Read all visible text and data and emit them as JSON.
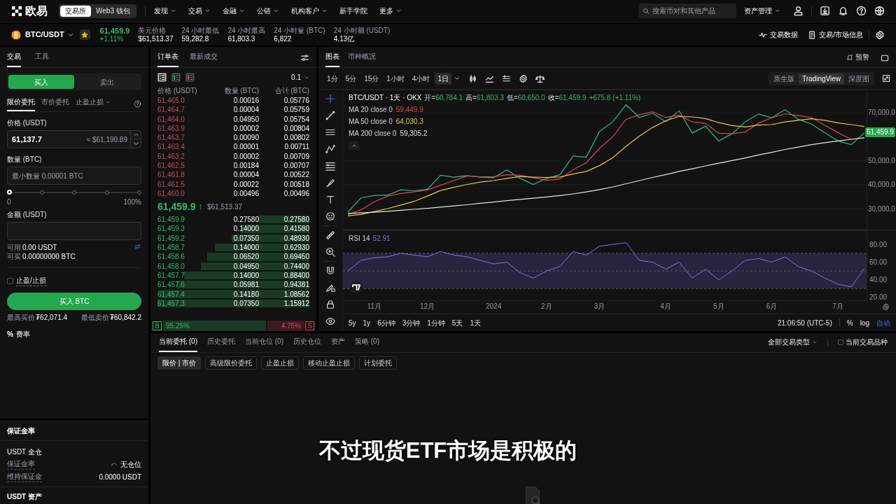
{
  "nav": {
    "logo_text": "欧易",
    "segments": [
      {
        "label": "交易所",
        "selected": true
      },
      {
        "label": "Web3 钱包",
        "selected": false
      }
    ],
    "menu": [
      {
        "label": "发现",
        "dropdown": true
      },
      {
        "label": "交易",
        "dropdown": true
      },
      {
        "label": "金融",
        "dropdown": true
      },
      {
        "label": "公链",
        "dropdown": true
      },
      {
        "label": "机构客户",
        "dropdown": true
      },
      {
        "label": "新手学院",
        "dropdown": false
      },
      {
        "label": "更多",
        "dropdown": true
      }
    ],
    "search": {
      "placeholder": "搜索币对和其他产品"
    },
    "asset_menu": "资产管理"
  },
  "ticker": {
    "pair": "BTC/USDT",
    "favorite": true,
    "last": "61,459.9",
    "change": "+1.11%",
    "stats": [
      {
        "label": "美元价格",
        "value": "$61,513.37"
      },
      {
        "label": "24 小时最低",
        "value": "59,282.8"
      },
      {
        "label": "24 小时最高",
        "value": "61,803.3"
      },
      {
        "label": "24 小时量 (BTC)",
        "value": "6,822"
      },
      {
        "label": "24 小时额 (USDT)",
        "value": "4.13亿"
      }
    ],
    "links": [
      {
        "label": "交易数据",
        "kind": "pulse"
      },
      {
        "label": "交易/市场信息",
        "kind": "doc"
      }
    ]
  },
  "trade_panel": {
    "tabs": [
      {
        "label": "交易",
        "selected": true
      },
      {
        "label": "工具",
        "selected": false
      }
    ],
    "sides": [
      {
        "label": "买入",
        "selected": true
      },
      {
        "label": "卖出",
        "selected": false
      }
    ],
    "order_types": [
      {
        "label": "限价委托",
        "selected": true,
        "dropdown": false
      },
      {
        "label": "市价委托",
        "selected": false,
        "dropdown": false
      },
      {
        "label": "止盈止损",
        "selected": false,
        "dropdown": true
      }
    ],
    "price_label": "价格 (USDT)",
    "price_value": "61,137.7",
    "price_usd": "≈ $61,190.89",
    "qty_label": "数量 (BTC)",
    "qty_placeholder": "最小数量 0.00001 BTC",
    "slider": {
      "level": 0,
      "min_label": "0",
      "max_label": "100%"
    },
    "amount_label": "金额 (USDT)",
    "available": [
      {
        "label": "可用",
        "value": "0.00 USDT"
      },
      {
        "label": "可买",
        "value": "0.00000000 BTC"
      }
    ],
    "tpsl": {
      "label": "止盈/止损",
      "checked": false
    },
    "submit": "买入 BTC",
    "limits": [
      {
        "label": "最高买价",
        "value": "₮62,071.4"
      },
      {
        "label": "最低卖价",
        "value": "₮60,842.2"
      }
    ],
    "fee_icon": "%",
    "fee": "费率"
  },
  "margin": {
    "title": "保证金率",
    "account": "USDT 全仓",
    "rows": [
      {
        "label": "保证金率",
        "value": "无仓位",
        "kind": "gauge"
      },
      {
        "label": "维持保证金",
        "value": "0.0000 USDT",
        "kind": "text"
      }
    ],
    "assets_title": "USDT 资产"
  },
  "orderbook": {
    "tabs": [
      {
        "label": "订单表",
        "selected": true
      },
      {
        "label": "最新成交",
        "selected": false
      }
    ],
    "views": [
      {
        "kind": "both",
        "selected": true
      },
      {
        "kind": "bids",
        "selected": false
      },
      {
        "kind": "asks",
        "selected": false
      }
    ],
    "precision": "0.1",
    "columns": [
      "价格 (USDT)",
      "数量 (BTC)",
      "合计 (BTC)"
    ],
    "asks": [
      {
        "price": "61,465.0",
        "amount": "0.00016",
        "total": "0.05776"
      },
      {
        "price": "61,464.7",
        "amount": "0.00004",
        "total": "0.05759"
      },
      {
        "price": "61,464.0",
        "amount": "0.04950",
        "total": "0.05754"
      },
      {
        "price": "61,463.9",
        "amount": "0.00002",
        "total": "0.00804"
      },
      {
        "price": "61,463.7",
        "amount": "0.00090",
        "total": "0.00802"
      },
      {
        "price": "61,463.4",
        "amount": "0.00001",
        "total": "0.00711"
      },
      {
        "price": "61,463.2",
        "amount": "0.00002",
        "total": "0.00709"
      },
      {
        "price": "61,462.5",
        "amount": "0.00184",
        "total": "0.00707"
      },
      {
        "price": "61,461.8",
        "amount": "0.00004",
        "total": "0.00522"
      },
      {
        "price": "61,461.5",
        "amount": "0.00022",
        "total": "0.00518"
      },
      {
        "price": "61,460.0",
        "amount": "0.00496",
        "total": "0.00496"
      }
    ],
    "last_price": "61,459.9",
    "last_arrow": "↑",
    "last_usd": "$61,513.37",
    "bids": [
      {
        "price": "61,459.9",
        "amount": "0.27580",
        "total": "0.27580"
      },
      {
        "price": "61,459.3",
        "amount": "0.14000",
        "total": "0.41580"
      },
      {
        "price": "61,459.2",
        "amount": "0.07350",
        "total": "0.48930"
      },
      {
        "price": "61,458.7",
        "amount": "0.14000",
        "total": "0.62930"
      },
      {
        "price": "61,458.6",
        "amount": "0.06520",
        "total": "0.69450"
      },
      {
        "price": "61,458.0",
        "amount": "0.04950",
        "total": "0.74400"
      },
      {
        "price": "61,457.7",
        "amount": "0.14000",
        "total": "0.88400"
      },
      {
        "price": "61,457.6",
        "amount": "0.05981",
        "total": "0.94381"
      },
      {
        "price": "61,457.4",
        "amount": "0.14180",
        "total": "1.08562"
      },
      {
        "price": "61,457.3",
        "amount": "0.07350",
        "total": "1.15912"
      }
    ],
    "ratio": {
      "buy_label": "B",
      "buy": "95.25%",
      "sell": "4.75%",
      "sell_label": "S"
    }
  },
  "chart_panel": {
    "tabs": [
      {
        "label": "图表",
        "selected": true
      },
      {
        "label": "币种概况",
        "selected": false
      }
    ],
    "alert": "预警",
    "intervals": [
      {
        "label": "1分",
        "selected": false
      },
      {
        "label": "5分",
        "selected": false
      },
      {
        "label": "15分",
        "selected": false
      },
      {
        "label": "1小时",
        "selected": false
      },
      {
        "label": "4小时",
        "selected": false
      },
      {
        "label": "1日",
        "selected": true
      }
    ],
    "views": [
      {
        "label": "原生版",
        "selected": false
      },
      {
        "label": "TradingView",
        "selected": true
      },
      {
        "label": "深度图",
        "selected": false
      }
    ],
    "legend": {
      "title": "BTC/USDT · 1天 · OKX",
      "ohlc": [
        {
          "label": "开=",
          "value": "60,784.1"
        },
        {
          "label": "高=",
          "value": "61,803.3"
        },
        {
          "label": "低=",
          "value": "60,650.0"
        },
        {
          "label": "收=",
          "value": "61,459.9"
        }
      ],
      "change": "+675.8 (+1.11%)",
      "mas": [
        {
          "label": "MA 20 close 0",
          "value": "59,449.9"
        },
        {
          "label": "MA 50 close 0",
          "value": "64,030.3"
        },
        {
          "label": "MA 200 close 0",
          "value": "59,305.2"
        }
      ]
    },
    "price_tag": "61,459.9",
    "chart_data": {
      "type": "line",
      "ylim": [
        21300,
        79300
      ],
      "yticks": [
        {
          "value": 30000,
          "label": "30,000.0"
        },
        {
          "value": 40000,
          "label": "40,000.0"
        },
        {
          "value": 50000,
          "label": "50,000.0"
        },
        {
          "value": 70000,
          "label": "70,000.0"
        }
      ],
      "series": [
        {
          "color": "#2ebd85",
          "values": [
            28500,
            34500,
            35400,
            35600,
            37800,
            37400,
            38000,
            43800,
            43000,
            43700,
            43000,
            42800,
            46000,
            42500,
            40000,
            42500,
            44000,
            51800,
            51300,
            62000,
            66000,
            73000,
            67800,
            69500,
            66000,
            70500,
            61300,
            64200,
            58000,
            61000,
            66000,
            69200,
            67600,
            71000,
            67000,
            65000,
            61500,
            58000,
            56500,
            61500
          ]
        },
        {
          "color": "#e0454f",
          "values": [
            27500,
            29500,
            32800,
            35200,
            36300,
            36900,
            37700,
            39700,
            41600,
            43500,
            43200,
            43200,
            44000,
            43800,
            42800,
            41700,
            42200,
            46100,
            49000,
            55000,
            59800,
            67000,
            68900,
            70100,
            67800,
            68700,
            65900,
            65300,
            61200,
            61100,
            61700,
            65400,
            67600,
            69300,
            68500,
            67700,
            64500,
            61500,
            58700,
            59400
          ]
        },
        {
          "color": "#e8c547",
          "values": [
            27000,
            27600,
            28800,
            30000,
            31500,
            33000,
            35200,
            37500,
            38800,
            40000,
            41000,
            41600,
            42500,
            43300,
            43000,
            42900,
            43100,
            44300,
            45400,
            47800,
            51100,
            55800,
            60000,
            63600,
            66400,
            68200,
            68000,
            67300,
            65600,
            64400,
            63800,
            64600,
            64800,
            65900,
            66600,
            67200,
            66600,
            65500,
            64800,
            64000
          ]
        },
        {
          "color": "#e6e6e6",
          "values": [
            28000,
            28200,
            28500,
            28900,
            29300,
            29700,
            30100,
            30600,
            31100,
            31600,
            32200,
            32700,
            33300,
            33800,
            34300,
            34800,
            35400,
            36100,
            36900,
            37900,
            39000,
            40300,
            41600,
            42900,
            44100,
            45400,
            46500,
            47700,
            48800,
            49900,
            51000,
            52200,
            53300,
            54500,
            55500,
            56500,
            57300,
            58000,
            58700,
            59300
          ]
        }
      ]
    },
    "rsi": {
      "label": "RSI 14",
      "value": "52.91",
      "chart_data": {
        "type": "line",
        "ylim": [
          16,
          96
        ],
        "categories": [
          null,
          null,
          "11月",
          null,
          null,
          null,
          "12月",
          null,
          null,
          null,
          null,
          "2024",
          null,
          null,
          null,
          "2月",
          null,
          null,
          null,
          "3月",
          null,
          null,
          null,
          null,
          "4月",
          null,
          null,
          null,
          "5月",
          null,
          null,
          null,
          "6月",
          null,
          null,
          null,
          null,
          "7月",
          null,
          null
        ],
        "yticks": [
          {
            "value": 20,
            "label": "20.00"
          },
          {
            "value": 40,
            "label": "40.00"
          },
          {
            "value": 60,
            "label": "60.00"
          },
          {
            "value": 80,
            "label": "80.00"
          }
        ],
        "series": [
          {
            "color": "#8f6fd8",
            "values": [
              50,
              62,
              65,
              66,
              70,
              68,
              66,
              72,
              68,
              66,
              62,
              58,
              60,
              48,
              42,
              50,
              55,
              72,
              68,
              78,
              80,
              82,
              62,
              60,
              52,
              60,
              42,
              52,
              40,
              50,
              62,
              64,
              60,
              66,
              55,
              50,
              42,
              35,
              32,
              53
            ]
          }
        ]
      }
    },
    "ranges": [
      "5y",
      "1y",
      "6分钟",
      "3分钟",
      "1分钟",
      "5天",
      "1天"
    ],
    "time": "21:06:50 (UTC-5)",
    "scale_options": [
      {
        "label": "%",
        "selected": false
      },
      {
        "label": "log",
        "selected": false
      },
      {
        "label": "自动",
        "selected": true
      }
    ]
  },
  "bottom": {
    "tabs": [
      {
        "label": "当前委托 (0)",
        "selected": true
      },
      {
        "label": "历史委托",
        "selected": false
      },
      {
        "label": "当前仓位 (0)",
        "selected": false
      },
      {
        "label": "历史仓位",
        "selected": false
      },
      {
        "label": "资产",
        "selected": false
      },
      {
        "label": "策略 (0)",
        "selected": false
      }
    ],
    "filter": "全部交易类型",
    "current_only": {
      "label": "当前交易品种",
      "checked": false
    },
    "order_filters": [
      {
        "label": "限价 | 市价",
        "selected": true
      },
      {
        "label": "高级限价委托",
        "selected": false
      },
      {
        "label": "止盈止损",
        "selected": false
      },
      {
        "label": "移动止盈止损",
        "selected": false
      },
      {
        "label": "计划委托",
        "selected": false
      }
    ]
  },
  "subtitle": "不过现货ETF市场是积极的"
}
